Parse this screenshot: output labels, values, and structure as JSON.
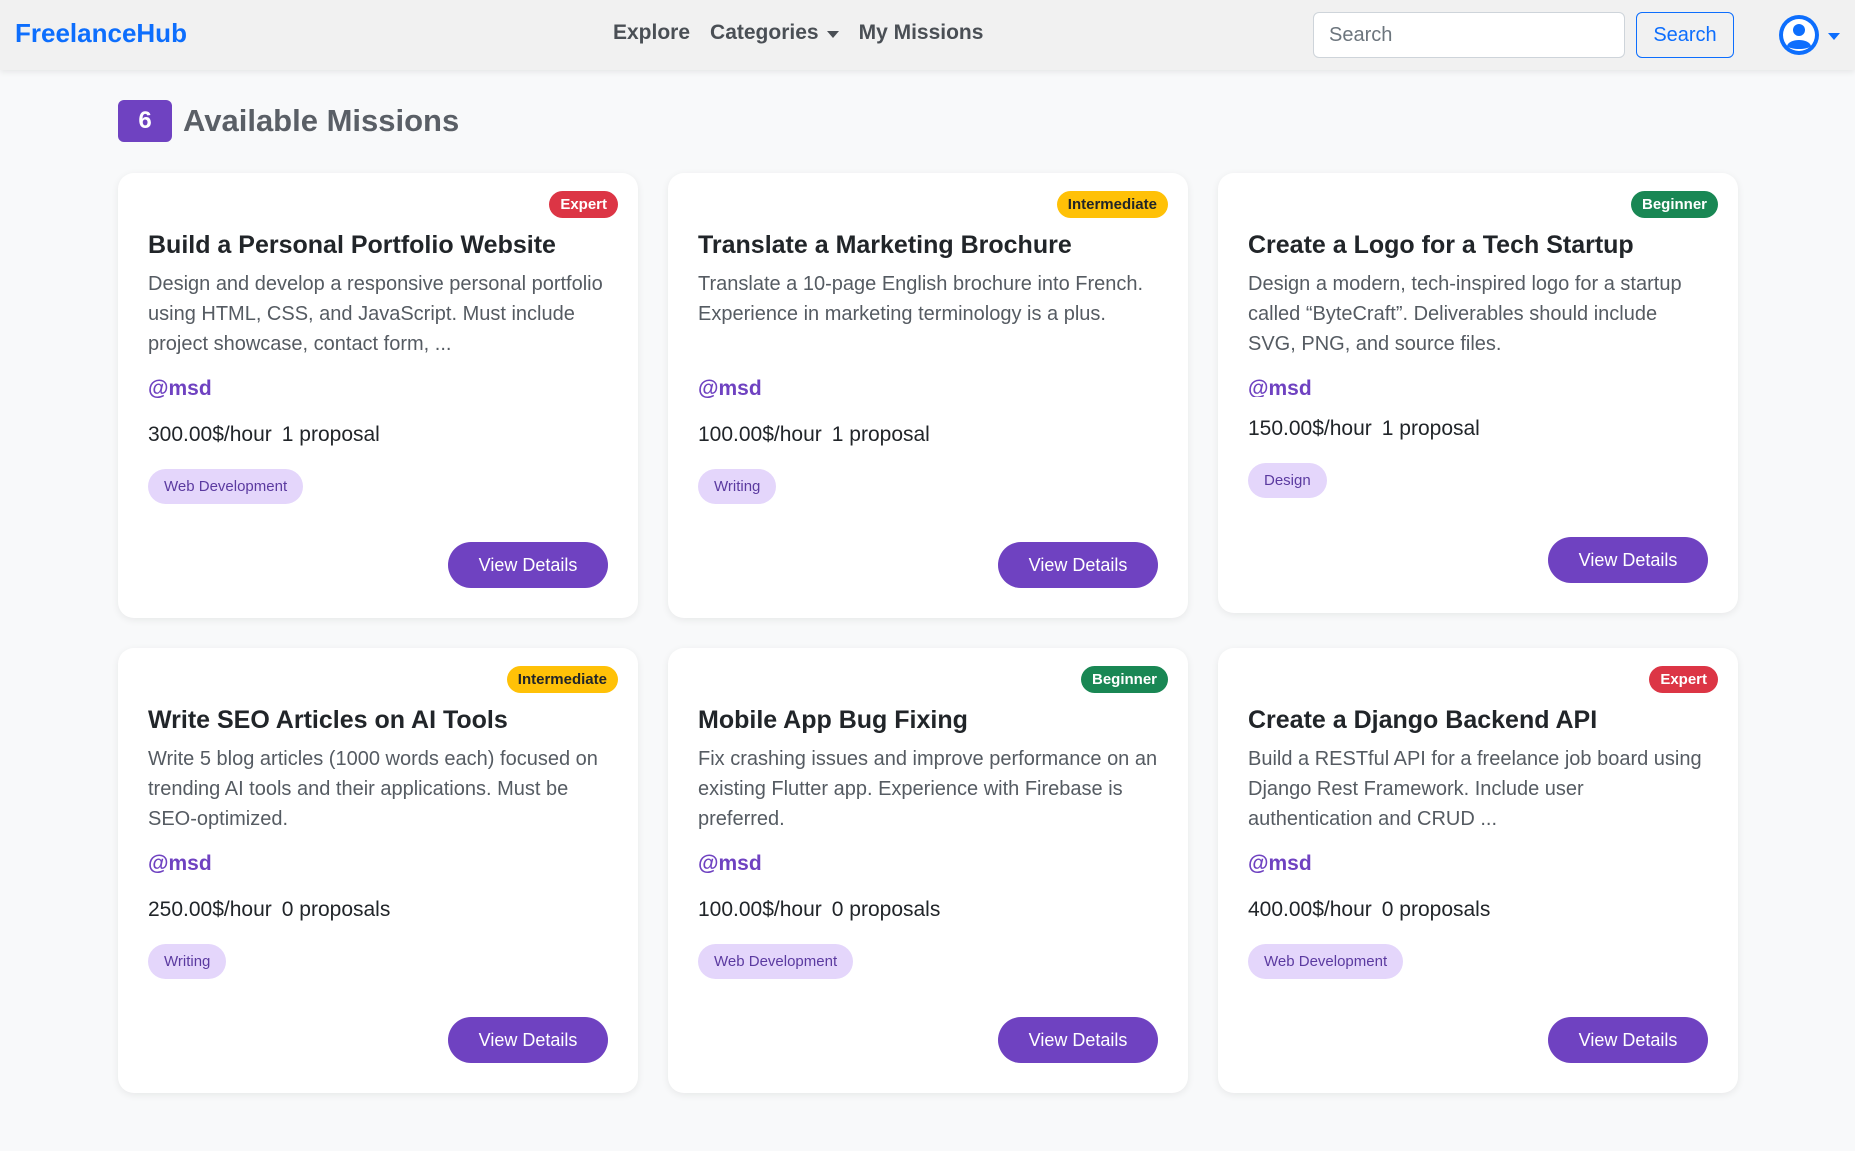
{
  "navbar": {
    "brand": "FreelanceHub",
    "links": {
      "explore": "Explore",
      "categories": "Categories",
      "my_missions": "My Missions"
    },
    "search": {
      "placeholder": "Search",
      "button_label": "Search"
    }
  },
  "page": {
    "count": "6",
    "title": "Available Missions",
    "view_details_label": "View Details"
  },
  "missions": [
    {
      "level": "Expert",
      "title": "Build a Personal Portfolio Website",
      "description": "Design and develop a responsive personal portfolio using HTML, CSS, and JavaScript. Must include project showcase, contact form, ...",
      "user": "@msd",
      "rate": "300.00$/hour",
      "proposals": "1 proposal",
      "tag": "Web Development"
    },
    {
      "level": "Intermediate",
      "title": "Translate a Marketing Brochure",
      "description": "Translate a 10-page English brochure into French. Experience in marketing terminology is a plus.",
      "user": "@msd",
      "rate": "100.00$/hour",
      "proposals": "1 proposal",
      "tag": "Writing"
    },
    {
      "level": "Beginner",
      "title": "Create a Logo for a Tech Startup",
      "description": "Design a modern, tech-inspired logo for a startup called “ByteCraft”. Deliverables should include SVG, PNG, and source files.",
      "user": "@msd",
      "rate": "150.00$/hour",
      "proposals": "1 proposal",
      "tag": "Design"
    },
    {
      "level": "Intermediate",
      "title": "Write SEO Articles on AI Tools",
      "description": "Write 5 blog articles (1000 words each) focused on trending AI tools and their applications. Must be SEO-optimized.",
      "user": "@msd",
      "rate": "250.00$/hour",
      "proposals": "0 proposals",
      "tag": "Writing"
    },
    {
      "level": "Beginner",
      "title": "Mobile App Bug Fixing",
      "description": "Fix crashing issues and improve performance on an existing Flutter app. Experience with Firebase is preferred.",
      "user": "@msd",
      "rate": "100.00$/hour",
      "proposals": "0 proposals",
      "tag": "Web Development"
    },
    {
      "level": "Expert",
      "title": "Create a Django Backend API",
      "description": "Build a RESTful API for a freelance job board using Django Rest Framework. Include user authentication and CRUD ...",
      "user": "@msd",
      "rate": "400.00$/hour",
      "proposals": "0 proposals",
      "tag": "Web Development"
    }
  ],
  "colors": {
    "brand": "#0d6efd",
    "accent": "#6f42c1",
    "expert": "#dc3545",
    "intermediate": "#ffc107",
    "beginner": "#198754",
    "tag_bg": "#e4d6fb"
  },
  "icons": {
    "user_menu": "user-circle-icon",
    "dropdown": "chevron-down-icon"
  }
}
